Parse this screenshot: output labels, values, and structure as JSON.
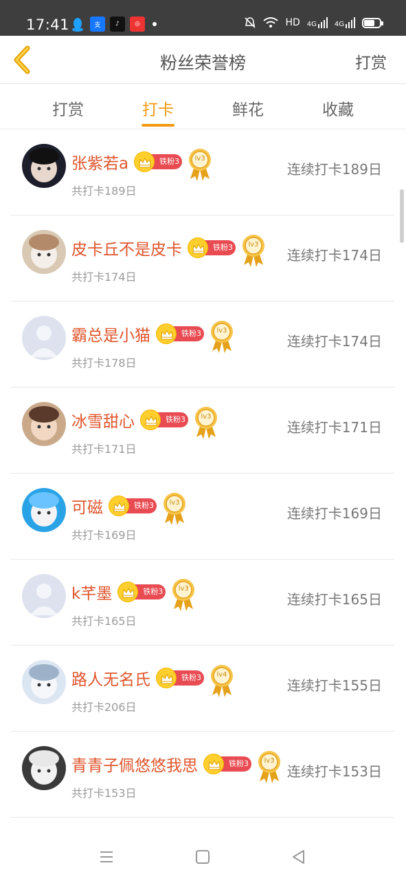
{
  "status_bar": {
    "time": "17:41",
    "hd": "HD",
    "signal1": "4G",
    "signal2": "4G",
    "battery_level": 0.7
  },
  "header": {
    "title": "粉丝荣誉榜",
    "right_action": "打赏"
  },
  "tabs": [
    {
      "label": "打赏",
      "active": false
    },
    {
      "label": "打卡",
      "active": true
    },
    {
      "label": "鲜花",
      "active": false
    },
    {
      "label": "收藏",
      "active": false
    }
  ],
  "rows": [
    {
      "name": "张紫若a",
      "badge": "铁粉3",
      "medal": "lv3",
      "total": "共打卡189日",
      "streak": "连续打卡189日",
      "avatar": "dark-portrait"
    },
    {
      "name": "皮卡丘不是皮卡",
      "badge": "铁粉3",
      "medal": "lv3",
      "total": "共打卡174日",
      "streak": "连续打卡174日",
      "avatar": "cat"
    },
    {
      "name": "霸总是小猫",
      "badge": "铁粉3",
      "medal": "lv3",
      "total": "共打卡178日",
      "streak": "连续打卡174日",
      "avatar": "default"
    },
    {
      "name": "冰雪甜心",
      "badge": "铁粉3",
      "medal": "lv3",
      "total": "共打卡171日",
      "streak": "连续打卡171日",
      "avatar": "baby"
    },
    {
      "name": "可磁",
      "badge": "铁粉3",
      "medal": "lv3",
      "total": "共打卡169日",
      "streak": "连续打卡169日",
      "avatar": "blue-anime"
    },
    {
      "name": "k芊墨",
      "badge": "铁粉3",
      "medal": "lv3",
      "total": "共打卡165日",
      "streak": "连续打卡165日",
      "avatar": "default"
    },
    {
      "name": "路人无名氏",
      "badge": "铁粉3",
      "medal": "lv4",
      "total": "共打卡206日",
      "streak": "连续打卡155日",
      "avatar": "white-anime"
    },
    {
      "name": "青青子佩悠悠我思",
      "badge": "铁粉3",
      "medal": "lv3",
      "total": "共打卡153日",
      "streak": "连续打卡153日",
      "avatar": "white-pet"
    }
  ],
  "icons": {
    "back": "chevron-left-icon",
    "nav_menu": "menu-icon",
    "nav_home": "square-icon",
    "nav_back": "triangle-back-icon"
  },
  "colors": {
    "accent": "#f29a12",
    "name": "#e0552d",
    "badge": "#e94b52"
  }
}
